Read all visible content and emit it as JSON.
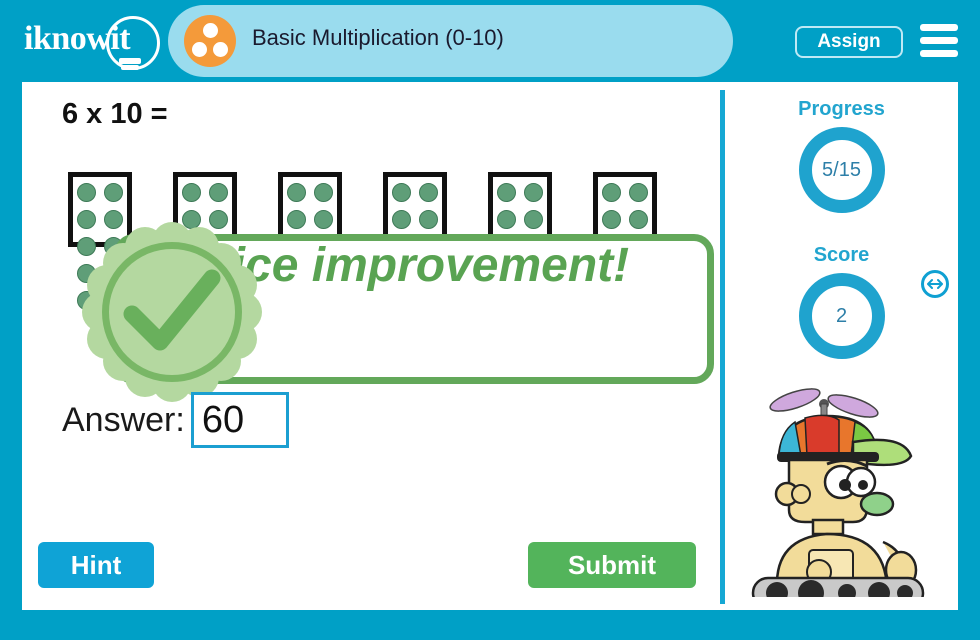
{
  "header": {
    "logo_text": "iknowit",
    "logo_icon": "lightbulb-icon",
    "topic_icon": "three-dots-circle-icon",
    "topic_title": "Basic Multiplication (0-10)",
    "assign_label": "Assign",
    "menu_icon": "hamburger-menu-icon"
  },
  "question": {
    "text": "6 x 10 =",
    "factor_a": 6,
    "factor_b": 10,
    "block_count": 6,
    "pips_per_block": 10
  },
  "feedback": {
    "message": "Nice improvement!",
    "icon": "check-badge-icon",
    "color": "#59a352"
  },
  "answer": {
    "label": "Answer:",
    "value": "60",
    "placeholder": ""
  },
  "buttons": {
    "hint_label": "Hint",
    "hint_color": "#0fa3d6",
    "submit_label": "Submit",
    "submit_color": "#53b45b"
  },
  "sidebar": {
    "progress_label": "Progress",
    "progress_value": "5/15",
    "score_label": "Score",
    "score_value": "2",
    "ring_color": "#1fa3ce",
    "mascot_icon": "robot-mascot-icon",
    "resize_icon": "resize-horizontal-icon"
  },
  "theme": {
    "frame_blue": "#00a0c6",
    "panel_blue": "#9adcee",
    "accent_orange": "#f49a3a"
  }
}
